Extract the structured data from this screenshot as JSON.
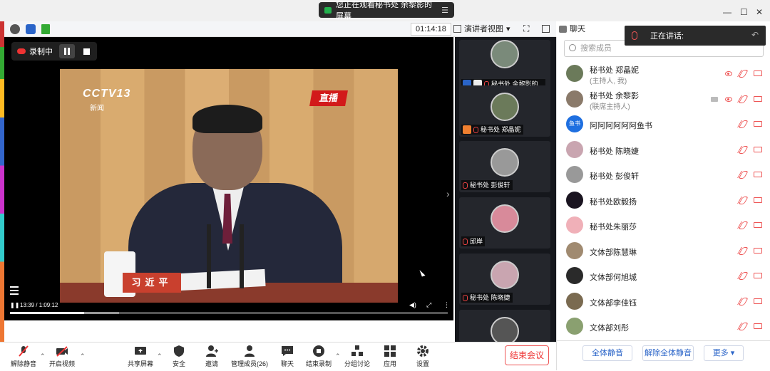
{
  "banner": {
    "text": "您正在观看秘书处 余黎影的屏幕"
  },
  "window": {
    "timer": "01:14:18",
    "view_label": "演讲者视图",
    "chat_label": "聊天"
  },
  "recording": {
    "label": "录制中"
  },
  "video": {
    "channel_logo": "CCTV13",
    "channel_sub": "新闻",
    "live_badge": "直播",
    "nameplate": "习近平",
    "time": "13:39 / 1:09:12",
    "progress_fraction": 0.17
  },
  "gallery": {
    "tiles": [
      {
        "name": "秘书处 余黎影的..."
      },
      {
        "name": "秘书处 郑晶妮"
      },
      {
        "name": "秘书处 彭俊轩"
      },
      {
        "name": "邱岸"
      },
      {
        "name": "秘书处 陈晓婕"
      }
    ]
  },
  "speaking": {
    "label": "正在讲话:"
  },
  "members": {
    "search_placeholder": "搜索成员",
    "list": [
      {
        "name": "秘书处 郑晶妮",
        "role": "(主持人, 我)",
        "avatar_color": "#6b7a5a"
      },
      {
        "name": "秘书处 余黎影",
        "role": "(联席主持人)",
        "avatar_color": "#8a7a6a"
      },
      {
        "name": "阿阿阿阿阿阿鱼书",
        "role": "",
        "avatar_text": "鱼书",
        "avatar_color": "#1e6fe0"
      },
      {
        "name": "秘书处 陈晓婕",
        "role": "",
        "avatar_color": "#c9a5b0"
      },
      {
        "name": "秘书处 彭俊轩",
        "role": "",
        "avatar_color": "#999999"
      },
      {
        "name": "秘书处欧毅扬",
        "role": "",
        "avatar_color": "#1a1420"
      },
      {
        "name": "秘书处朱丽莎",
        "role": "",
        "avatar_color": "#f0b0b8"
      },
      {
        "name": "文体部陈慧琳",
        "role": "",
        "avatar_color": "#a08a70"
      },
      {
        "name": "文体部何旭城",
        "role": "",
        "avatar_color": "#2a2a2a"
      },
      {
        "name": "文体部李佳钰",
        "role": "",
        "avatar_color": "#7a6a50"
      },
      {
        "name": "文体部刘彤",
        "role": "",
        "avatar_color": "#8aa070"
      }
    ],
    "mute_all": "全体静音",
    "unmute_all": "解除全体静音",
    "more": "更多"
  },
  "toolbar": {
    "unmute": "解除静音",
    "start_video": "开启视频",
    "share_screen": "共享屏幕",
    "security": "安全",
    "invite": "邀请",
    "manage_members": "管理成员(26)",
    "chat": "聊天",
    "stop_recording": "结束录制",
    "breakout": "分组讨论",
    "apps": "应用",
    "settings": "设置",
    "end_meeting": "结束会议"
  },
  "colors": {
    "accent": "#2a64c8",
    "danger": "#e33333",
    "banner_green": "#23b14d"
  }
}
